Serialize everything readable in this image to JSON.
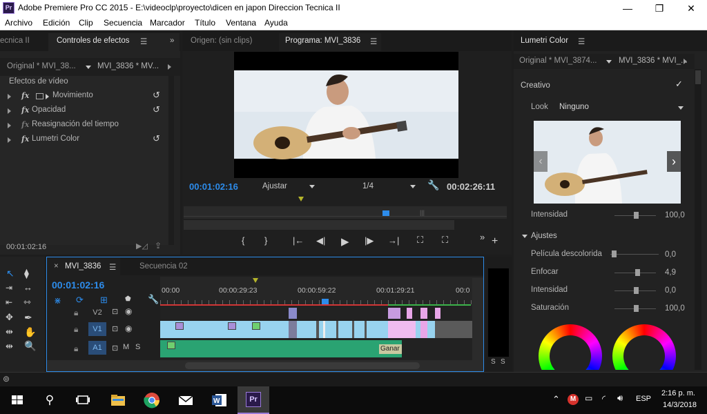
{
  "window": {
    "title": "Adobe Premiere Pro CC 2015 - E:\\videoclp\\proyecto\\dicen en japon Direccion Tecnica II",
    "icon_text": "Pr",
    "minimize": "—",
    "maximize": "❐",
    "close": "✕"
  },
  "menu": [
    "Archivo",
    "Edición",
    "Clip",
    "Secuencia",
    "Marcador",
    "Título",
    "Ventana",
    "Ayuda"
  ],
  "effects_panel": {
    "prev_tab": "ecnica II",
    "tab": "Controles de efectos",
    "source_clip": "Original * MVI_38...",
    "seq_clip": "MVI_3836 * MV...",
    "section": "Efectos de vídeo",
    "effects": [
      "Movimiento",
      "Opacidad",
      "Reasignación del tiempo",
      "Lumetri Color"
    ],
    "timecode": "00:01:02:16"
  },
  "program_monitor": {
    "source_tab": "Origen: (sin clips)",
    "tab": "Programa: MVI_3836",
    "timecode": "00:01:02:16",
    "fit": "Ajustar",
    "resolution": "1/4",
    "duration": "00:02:26:11",
    "buttons": [
      "{",
      "}",
      "|←",
      "◀|",
      "▶",
      "|▶",
      "→|"
    ]
  },
  "lumetri": {
    "tab": "Lumetri Color",
    "source_clip": "Original * MVI_3874...",
    "seq_clip": "MVI_3836 * MVI_...",
    "creative_label": "Creativo",
    "look_label": "Look",
    "look_value": "Ninguno",
    "intensity_label": "Intensidad",
    "intensity_value": "100,0",
    "adjustments_label": "Ajustes",
    "sliders": [
      {
        "label": "Película descolorida",
        "value": "0,0",
        "level": 0.0
      },
      {
        "label": "Enfocar",
        "value": "4,9",
        "level": 0.52
      },
      {
        "label": "Intensidad",
        "value": "0,0",
        "level": 0.5
      },
      {
        "label": "Saturación",
        "value": "100,0",
        "level": 0.5
      }
    ]
  },
  "timeline": {
    "tab": "MVI_3836",
    "tab2": "Secuencia 02",
    "timecode": "00:01:02:16",
    "ruler": [
      "00:00",
      "00:00:29:23",
      "00:00:59:22",
      "00:01:29:21",
      "00:0"
    ],
    "tracks": [
      {
        "name": "V2",
        "type": "video"
      },
      {
        "name": "V1",
        "type": "video"
      },
      {
        "name": "A1",
        "type": "audio",
        "m": "M",
        "s": "S"
      }
    ],
    "clip_label": "Ganar",
    "meter_labels": [
      "S",
      "S"
    ]
  },
  "taskbar": {
    "time": "2:16 p. m.",
    "date": "14/3/2018",
    "lang": "ESP"
  }
}
